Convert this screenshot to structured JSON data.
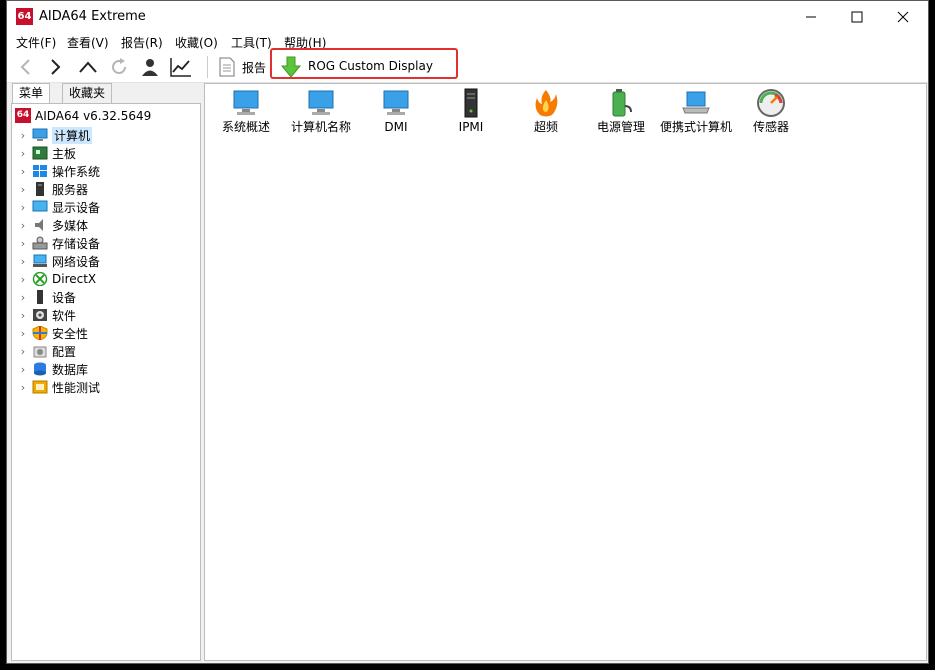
{
  "window": {
    "title": "AIDA64 Extreme",
    "logo": "64"
  },
  "menu": [
    "文件(F)",
    "查看(V)",
    "报告(R)",
    "收藏(O)",
    "工具(T)",
    "帮助(H)"
  ],
  "toolbar": {
    "report_label": "报告",
    "rog_label": "ROG Custom Display"
  },
  "tabs": {
    "menu": "菜单",
    "favorites": "收藏夹"
  },
  "tree": {
    "root": "AIDA64 v6.32.5649",
    "items": [
      "计算机",
      "主板",
      "操作系统",
      "服务器",
      "显示设备",
      "多媒体",
      "存储设备",
      "网络设备",
      "DirectX",
      "设备",
      "软件",
      "安全性",
      "配置",
      "数据库",
      "性能测试"
    ]
  },
  "tiles": [
    "系统概述",
    "计算机名称",
    "DMI",
    "IPMI",
    "超频",
    "电源管理",
    "便携式计算机",
    "传感器"
  ],
  "colors": {
    "accent": "#c8102e",
    "highlight": "#e03030",
    "selection": "#cce8ff"
  }
}
